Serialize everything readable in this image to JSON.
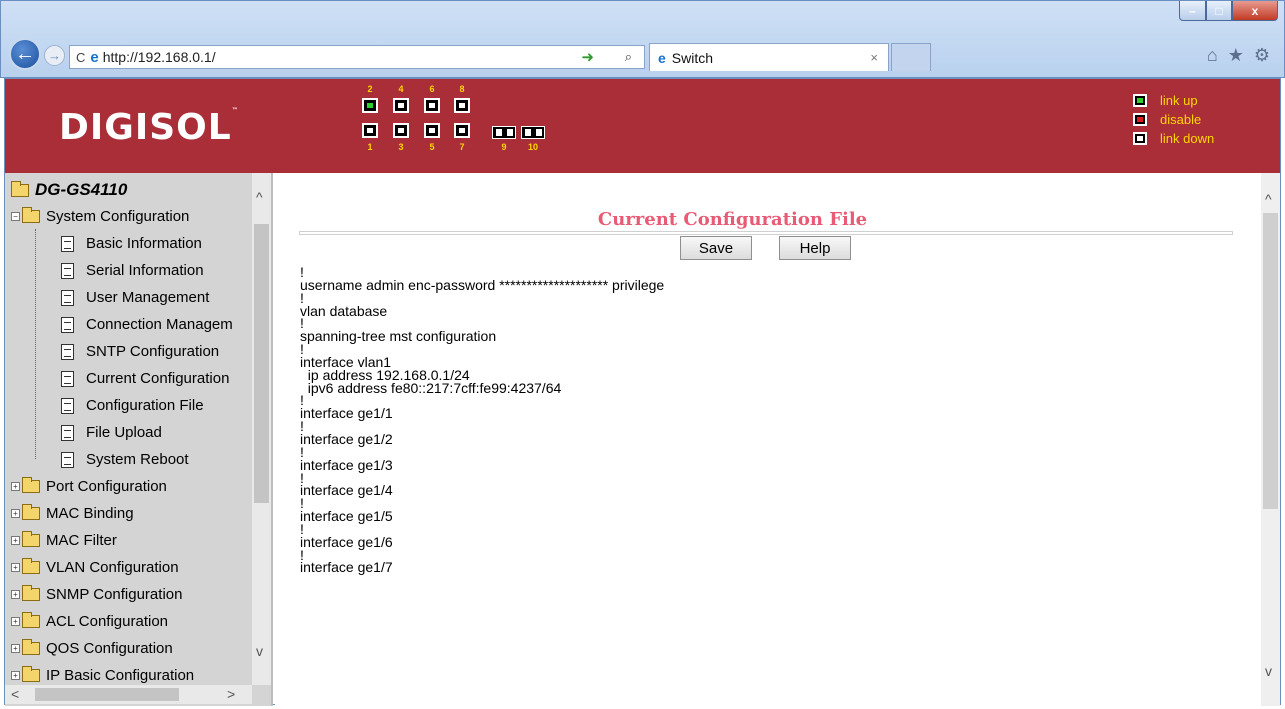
{
  "browser": {
    "url": "http://192.168.0.1/",
    "tab_title": "Switch",
    "tab_close": "×",
    "back": "←",
    "forward": "→",
    "refresh": "C",
    "search_icon": "⌕",
    "go_icon": "➜",
    "tools": {
      "home": "⌂",
      "favorites": "★",
      "settings": "⚙"
    },
    "window": {
      "minimize": "–",
      "maximize": "□",
      "close": "x"
    }
  },
  "banner": {
    "logo": "DIGISOL",
    "logo_tm": "™",
    "ports_top_numbers": [
      "2",
      "4",
      "6",
      "8"
    ],
    "ports_bottom_numbers": [
      "1",
      "3",
      "5",
      "7"
    ],
    "sfp_numbers": [
      "9",
      "10"
    ],
    "ports": [
      {
        "number": "2",
        "state": "link up"
      },
      {
        "number": "4",
        "state": "link down"
      },
      {
        "number": "6",
        "state": "link down"
      },
      {
        "number": "8",
        "state": "link down"
      },
      {
        "number": "1",
        "state": "link down"
      },
      {
        "number": "3",
        "state": "link down"
      },
      {
        "number": "5",
        "state": "link down"
      },
      {
        "number": "7",
        "state": "link down"
      }
    ],
    "legend": [
      {
        "label": "link up",
        "state": "up"
      },
      {
        "label": "disable",
        "state": "disable"
      },
      {
        "label": "link down",
        "state": "down"
      }
    ]
  },
  "sidebar": {
    "root": "DG-GS4110",
    "system_folder": "System Configuration",
    "system_items": [
      "Basic Information",
      "Serial Information",
      "User Management",
      "Connection Managem",
      "SNTP Configuration",
      "Current Configuration",
      "Configuration File",
      "File Upload",
      "System Reboot"
    ],
    "folders": [
      "Port Configuration",
      "MAC Binding",
      "MAC Filter",
      "VLAN Configuration",
      "SNMP Configuration",
      "ACL Configuration",
      "QOS Configuration",
      "IP Basic Configuration"
    ],
    "expand_glyph": "+",
    "scroll_up": "^",
    "scroll_down": "v",
    "scroll_left": "<",
    "scroll_right": ">"
  },
  "main": {
    "title": "Current Configuration File",
    "save_label": "Save",
    "help_label": "Help",
    "config_text": "!\nusername admin enc-password ******************** privilege\n!\nvlan database\n!\nspanning-tree mst configuration\n!\ninterface vlan1\n  ip address 192.168.0.1/24\n  ipv6 address fe80::217:7cff:fe99:4237/64\n!\ninterface ge1/1\n!\ninterface ge1/2\n!\ninterface ge1/3\n!\ninterface ge1/4\n!\ninterface ge1/5\n!\ninterface ge1/6\n!\ninterface ge1/7",
    "scroll_up": "^",
    "scroll_down": "v"
  },
  "colors": {
    "banner": "#a92e37",
    "title": "#e85b74",
    "legend_text": "#ffd700",
    "link_up": "#2dcf2d",
    "disable": "#e01b1b"
  }
}
